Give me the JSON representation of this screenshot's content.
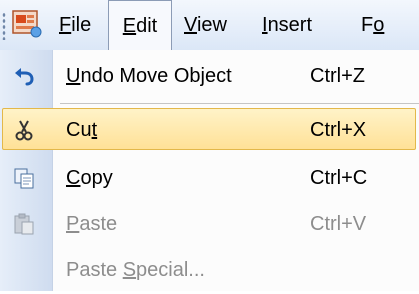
{
  "menubar": {
    "items": [
      {
        "pre": "",
        "ul": "F",
        "post": "ile"
      },
      {
        "pre": "",
        "ul": "E",
        "post": "dit"
      },
      {
        "pre": "",
        "ul": "V",
        "post": "iew"
      },
      {
        "pre": "",
        "ul": "I",
        "post": "nsert"
      },
      {
        "pre": "F",
        "ul": "o",
        "post": ""
      }
    ],
    "active_item": "Edit"
  },
  "edit_menu": {
    "items": [
      {
        "pre": "",
        "ul": "U",
        "post": "ndo Move Object",
        "shortcut": "Ctrl+Z",
        "icon": "undo-icon",
        "enabled": true,
        "highlighted": false
      },
      {
        "pre": "Cu",
        "ul": "t",
        "post": "",
        "shortcut": "Ctrl+X",
        "icon": "scissors-icon",
        "enabled": true,
        "highlighted": true
      },
      {
        "pre": "",
        "ul": "C",
        "post": "opy",
        "shortcut": "Ctrl+C",
        "icon": "copy-icon",
        "enabled": true,
        "highlighted": false
      },
      {
        "pre": "",
        "ul": "P",
        "post": "aste",
        "shortcut": "Ctrl+V",
        "icon": "paste-icon",
        "enabled": false,
        "highlighted": false
      },
      {
        "pre": "Paste ",
        "ul": "S",
        "post": "pecial...",
        "shortcut": "",
        "icon": "",
        "enabled": false,
        "highlighted": false
      }
    ]
  },
  "colors": {
    "highlight_fill": "#ffe197",
    "highlight_border": "#e3b84a",
    "disabled_text": "#8d8d8d"
  }
}
